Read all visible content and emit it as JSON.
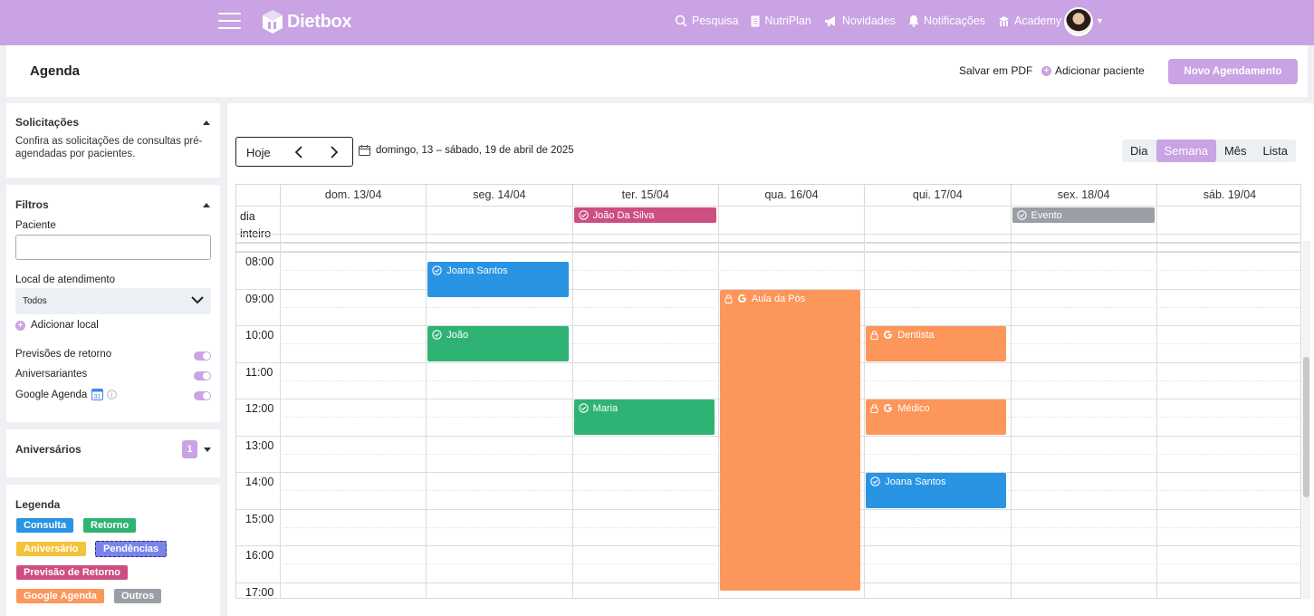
{
  "topbar": {
    "brand": "Dietbox",
    "nav": [
      {
        "label": "Pesquisa",
        "icon": "search-icon"
      },
      {
        "label": "NutriPlan",
        "icon": "document-icon"
      },
      {
        "label": "Novidades",
        "icon": "megaphone-icon"
      },
      {
        "label": "Notificações",
        "icon": "bell-icon"
      },
      {
        "label": "Academy",
        "icon": "academy-icon"
      }
    ],
    "avatar_caret": "▾"
  },
  "header": {
    "title": "Agenda",
    "save_pdf": "Salvar em PDF",
    "add_patient": "Adicionar paciente",
    "new_appointment": "Novo Agendamento"
  },
  "sidebar": {
    "requests": {
      "title": "Solicitações",
      "description": "Confira as solicitações de consultas pré-agendadas por pacientes."
    },
    "filters": {
      "title": "Filtros",
      "patient_label": "Paciente",
      "patient_value": "",
      "location_label": "Local de atendimento",
      "location_value": "Todos",
      "add_location": "Adicionar local",
      "toggles": [
        {
          "label": "Previsões de retorno",
          "on": true
        },
        {
          "label": "Aniversariantes",
          "on": true
        },
        {
          "label": "Google Agenda",
          "on": true
        }
      ]
    },
    "birthdays": {
      "title": "Aniversários",
      "count": "1"
    },
    "legend": {
      "title": "Legenda",
      "items": [
        {
          "label": "Consulta",
          "color": "#2994e3"
        },
        {
          "label": "Retorno",
          "color": "#2fb374"
        },
        {
          "label": "Aniversário",
          "color": "#f3c33c"
        },
        {
          "label": "Pendências",
          "color": "#7b83eb"
        },
        {
          "label": "Previsão de Retorno",
          "color": "#cd4f82"
        },
        {
          "label": "Google Agenda",
          "color": "#fd965a"
        },
        {
          "label": "Outros",
          "color": "#9a9ea7"
        }
      ]
    }
  },
  "calendar": {
    "today": "Hoje",
    "range": "domingo, 13 – sábado, 19 de abril de 2025",
    "views": [
      "Dia",
      "Semana",
      "Mês",
      "Lista"
    ],
    "active_view": "Semana",
    "all_day_label": "dia inteiro",
    "days": [
      "dom. 13/04",
      "seg. 14/04",
      "ter. 15/04",
      "qua. 16/04",
      "qui. 17/04",
      "sex. 18/04",
      "sáb. 19/04"
    ],
    "hours": [
      "08:00",
      "09:00",
      "10:00",
      "11:00",
      "12:00",
      "13:00",
      "14:00",
      "15:00",
      "16:00",
      "17:00"
    ],
    "all_day_events": [
      {
        "day": 2,
        "title": "João Da Silva",
        "color": "#cd4f82"
      },
      {
        "day": 5,
        "title": "Evento",
        "color": "#9a9ea7"
      }
    ],
    "events": [
      {
        "day": 1,
        "start": 8.25,
        "end": 9.25,
        "title": "Joana Santos",
        "color": "#2994e3",
        "kind": "check"
      },
      {
        "day": 1,
        "start": 10.0,
        "end": 11.0,
        "title": "João",
        "color": "#2fb374",
        "kind": "check"
      },
      {
        "day": 2,
        "start": 12.0,
        "end": 13.0,
        "title": "Maria",
        "color": "#2fb374",
        "kind": "check"
      },
      {
        "day": 3,
        "start": 9.0,
        "end": 17.25,
        "title": "Aula da Pós",
        "color": "#fd965a",
        "kind": "google"
      },
      {
        "day": 4,
        "start": 10.0,
        "end": 11.0,
        "title": "Dentista",
        "color": "#fd965a",
        "kind": "google"
      },
      {
        "day": 4,
        "start": 12.0,
        "end": 13.0,
        "title": "Médico",
        "color": "#fd965a",
        "kind": "google"
      },
      {
        "day": 4,
        "start": 14.0,
        "end": 15.0,
        "title": "Joana Santos",
        "color": "#2994e3",
        "kind": "check"
      }
    ]
  }
}
